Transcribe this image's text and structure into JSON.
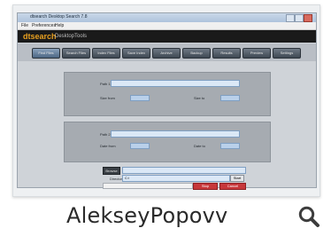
{
  "thumbnail": {
    "window_title": "dtsearch Desktop Search 7.8",
    "menu": [
      "File",
      "Preferences",
      "Help"
    ],
    "brand": "dtsearch",
    "brand_sub": "DesktopTools",
    "tabs": [
      "Find Files",
      "Search Files",
      "Index Files",
      "Save Index",
      "Archive",
      "Backup",
      "Results",
      "Preview",
      "Settings"
    ],
    "active_tab": 0,
    "panel1": {
      "label": "Path 1",
      "left_label": "Size from",
      "right_label": "Size to"
    },
    "panel2": {
      "label": "Path 2",
      "left_label": "Date from",
      "right_label": "Date to"
    },
    "bottom": {
      "browse_label": "Browse",
      "dir_label": "Directory",
      "dir_value": "C:\\",
      "start_label": "Start",
      "stop_label": "Stop",
      "cancel_label": "Cancel"
    }
  },
  "caption": "AlekseyPopovv",
  "colors": {
    "accent": "#e8a020",
    "brand_bar": "#1a1a1a",
    "stop_button": "#c7383b"
  }
}
